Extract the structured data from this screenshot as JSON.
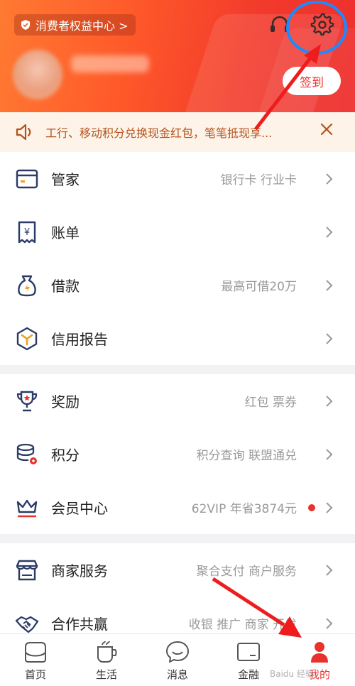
{
  "header": {
    "rights_label": "消费者权益中心 >",
    "sign_label": "签到"
  },
  "notice": {
    "text": "工行、移动积分兑换现金红包，笔笔抵现享..."
  },
  "groups": [
    [
      {
        "label": "管家",
        "sub": "银行卡 行业卡",
        "icon": "wallet-card-icon"
      },
      {
        "label": "账单",
        "sub": "",
        "icon": "bill-icon"
      },
      {
        "label": "借款",
        "sub": "最高可借20万",
        "icon": "money-bag-icon"
      },
      {
        "label": "信用报告",
        "sub": "",
        "icon": "credit-report-icon"
      }
    ],
    [
      {
        "label": "奖励",
        "sub": "红包 票券",
        "icon": "trophy-icon"
      },
      {
        "label": "积分",
        "sub": "积分查询 联盟通兑",
        "icon": "points-coins-icon"
      },
      {
        "label": "会员中心",
        "sub": "62VIP 年省3874元",
        "icon": "crown-icon"
      }
    ],
    [
      {
        "label": "商家服务",
        "sub": "聚合支付 商户服务",
        "icon": "shop-icon"
      },
      {
        "label": "合作共赢",
        "sub": "收银 推广 商家 开发",
        "icon": "handshake-icon"
      }
    ]
  ],
  "nav": [
    {
      "label": "首页",
      "icon": "home-icon"
    },
    {
      "label": "生活",
      "icon": "cup-icon"
    },
    {
      "label": "消息",
      "icon": "chat-icon"
    },
    {
      "label": "金融",
      "icon": "finance-card-icon"
    },
    {
      "label": "我的",
      "icon": "profile-icon"
    }
  ],
  "watermark": "Baidu 经验",
  "colors": {
    "accent": "#e8322c",
    "header_start": "#ff7a32",
    "header_end": "#ee2f2f",
    "annotation_ring": "#1a8cff",
    "notice_text": "#b2521c"
  }
}
